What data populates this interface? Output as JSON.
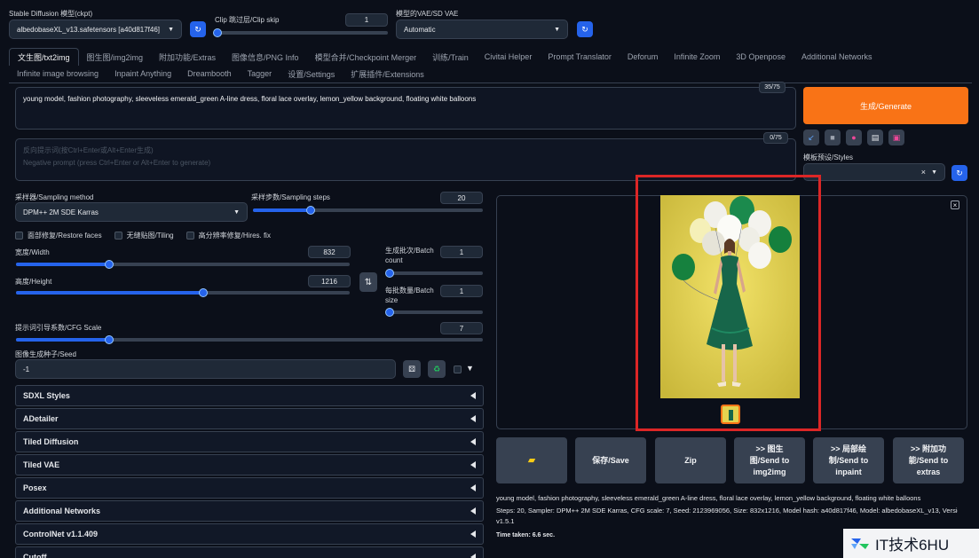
{
  "top": {
    "ckpt_label": "Stable Diffusion 模型(ckpt)",
    "ckpt_value": "albedobaseXL_v13.safetensors [a40d817f46]",
    "clip_label": "Clip 跳过层/Clip skip",
    "clip_value": "1",
    "vae_label": "模型的VAE/SD VAE",
    "vae_value": "Automatic"
  },
  "tabs_row1": [
    "文生图/txt2img",
    "图生图/img2img",
    "附加功能/Extras",
    "图像信息/PNG Info",
    "模型合并/Checkpoint Merger",
    "训练/Train",
    "Civitai Helper",
    "Prompt Translator",
    "Deforum",
    "Infinite Zoom",
    "3D Openpose",
    "Additional Networks"
  ],
  "tabs_row2": [
    "Infinite image browsing",
    "Inpaint Anything",
    "Dreambooth",
    "Tagger",
    "设置/Settings",
    "扩展插件/Extensions"
  ],
  "prompt": {
    "text": "young model, fashion photography, sleeveless emerald_green A-line dress, floral lace overlay, lemon_yellow background, floating white balloons",
    "counter": "35/75",
    "neg_placeholder_cn": "反向提示词(按Ctrl+Enter或Alt+Enter生成)",
    "neg_placeholder_en": "Negative prompt (press Ctrl+Enter or Alt+Enter to generate)",
    "neg_counter": "0/75"
  },
  "generate_label": "生成/Generate",
  "styles_label": "模板预设/Styles",
  "sampling": {
    "method_label": "采样器/Sampling method",
    "method_value": "DPM++ 2M SDE Karras",
    "steps_label": "采样步数/Sampling steps",
    "steps_value": "20",
    "steps_fraction": 0.25
  },
  "checks": [
    "面部修复/Restore faces",
    "无缝贴图/Tiling",
    "高分辨率修复/Hires. fix"
  ],
  "size": {
    "width_label": "宽度/Width",
    "width_value": "832",
    "width_fraction": 0.28,
    "height_label": "高度/Height",
    "height_value": "1216",
    "height_fraction": 0.56,
    "batch_count_label_1": "生成批次/Batch",
    "batch_count_label_2": "count",
    "batch_count_value": "1",
    "batch_size_label_1": "每批数量/Batch",
    "batch_size_label_2": "size",
    "batch_size_value": "1"
  },
  "cfg": {
    "label": "提示词引导系数/CFG Scale",
    "value": "7",
    "fraction": 0.2
  },
  "seed": {
    "label": "图像生成种子/Seed",
    "value": "-1"
  },
  "accordions": [
    "SDXL Styles",
    "ADetailer",
    "Tiled Diffusion",
    "Tiled VAE",
    "Posex",
    "Additional Networks",
    "ControlNet v1.1.409",
    "Cutoff"
  ],
  "actions": {
    "save": "保存/Save",
    "zip": "Zip",
    "send_img2img_1": ">> 图生",
    "send_img2img_2": "图/Send to",
    "send_img2img_3": "img2img",
    "send_inpaint_1": ">> 局部绘",
    "send_inpaint_2": "制/Send to",
    "send_inpaint_3": "inpaint",
    "send_extras_1": ">> 附加功",
    "send_extras_2": "能/Send to",
    "send_extras_3": "extras"
  },
  "info": {
    "prompt": "young model, fashion photography, sleeveless emerald_green A-line dress, floral lace overlay, lemon_yellow background, floating white balloons",
    "params_1": "Steps: 20, Sampler: DPM++ 2M SDE Karras, CFG scale: 7, Seed: 2123969056, Size: 832x1216, Model hash: a40d817f46, Model: albedobaseXL_v13, Version:",
    "params_2": "v1.5.1",
    "time": "Time taken: 6.6 sec."
  },
  "watermark": "IT技术6HU",
  "colors": {
    "accent": "#2563eb",
    "generate": "#f97316",
    "highlight": "#dc2626",
    "bg": "#0b0f19"
  }
}
